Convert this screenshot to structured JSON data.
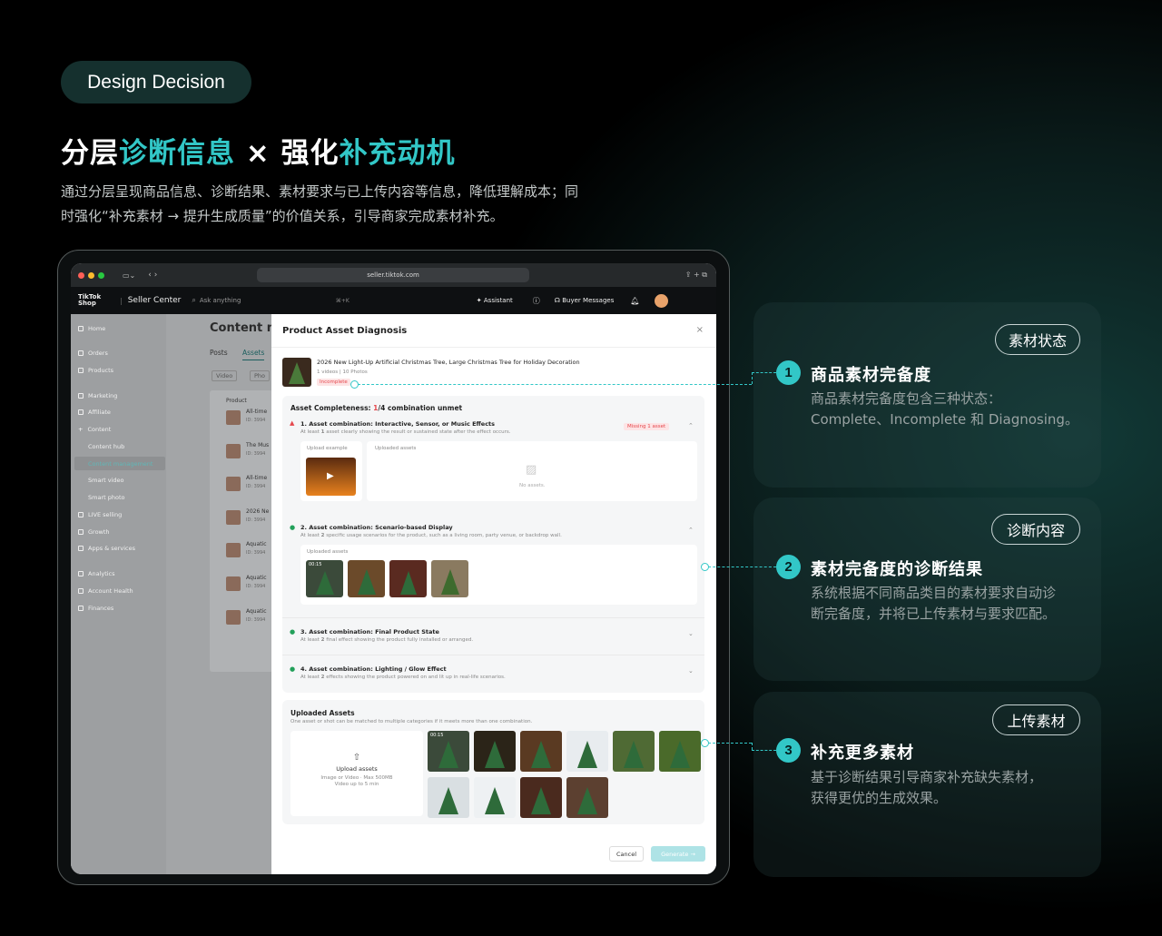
{
  "badge": "Design Decision",
  "headline": {
    "p1": "分层",
    "p2": "诊断信息",
    "p3": " × 强化",
    "p4": "补充动机"
  },
  "intro": "通过分层呈现商品信息、诊断结果、素材要求与已上传内容等信息，降低理解成本；同时强化“补充素材 → 提升生成质量”的价值关系，引导商家完成素材补充。",
  "browser": {
    "url": "seller.tiktok.com"
  },
  "topbar": {
    "brand": "TikTok Shop",
    "product": "Seller Center",
    "search_placeholder": "Ask anything",
    "shortcut": "⌘+K",
    "assistant": "Assistant",
    "buyer_messages": "Buyer Messages"
  },
  "sidebar": {
    "items": [
      "Home",
      "Orders",
      "Products",
      "Marketing",
      "Affiliate",
      "Content",
      "Content hub",
      "Content management",
      "Smart video",
      "Smart photo",
      "LIVE selling",
      "Growth",
      "Apps & services",
      "Analytics",
      "Account Health",
      "Finances"
    ]
  },
  "bg": {
    "title": "Content m",
    "tabs": [
      "Posts",
      "Assets"
    ],
    "chips": [
      "Video",
      "Pho"
    ],
    "col": "Product",
    "rows": [
      "All-time",
      "The Mus",
      "All-time",
      "2026 Ne",
      "Aquatic",
      "Aquatic",
      "Aquatic"
    ],
    "row_sub": "ID: 3994"
  },
  "modal": {
    "title": "Product Asset Diagnosis",
    "product_name": "2026 New Light-Up Artificial Christmas Tree, Large Christmas Tree for Holiday Decoration",
    "product_meta": "1 videos | 10 Photos",
    "status": "Incomplete",
    "completeness": {
      "label": "Asset Completeness: ",
      "unmet": "1",
      "rest": "/4 combination unmet"
    },
    "combos": [
      {
        "title": "1. Asset combination: Interactive, Sensor, or Music Effects",
        "desc_a": "At least ",
        "desc_n": "1",
        "desc_b": " asset clearly showing the result or sustained state after the effect occurs.",
        "badge": "Missing 1 asset"
      },
      {
        "title": "2. Asset combination: Scenario-based Display",
        "desc_a": "At least ",
        "desc_n": "2",
        "desc_b": " specific usage scenarios for the product, such as a living room, party venue, or backdrop wall."
      },
      {
        "title": "3. Asset combination: Final Product State",
        "desc_a": "At least ",
        "desc_n": "2",
        "desc_b": " final effect showing the product fully installed or arranged."
      },
      {
        "title": "4. Asset combination: Lighting / Glow Effect",
        "desc_a": "At least ",
        "desc_n": "2",
        "desc_b": " effects showing the product powered on and lit up in real-life scenarios."
      }
    ],
    "upload_example": "Upload example",
    "uploaded_assets_lbl": "Uploaded assets",
    "no_assets": "No assets.",
    "video_time": "00:15",
    "uploaded": {
      "title": "Uploaded Assets",
      "desc": "One asset or shot can be matched to multiple categories if it meets more than one combination.",
      "btn": "Upload assets",
      "hint1": "Image or Video · Max 500MB",
      "hint2": "Video up to 5 min"
    },
    "cancel": "Cancel",
    "generate": "Generate →"
  },
  "features": [
    {
      "num": "1",
      "tag": "素材状态",
      "title": "商品素材完备度",
      "desc1": "商品素材完备度包含三种状态：",
      "desc2": "Complete、Incomplete 和 Diagnosing。"
    },
    {
      "num": "2",
      "tag": "诊断内容",
      "title": "素材完备度的诊断结果",
      "desc1": "系统根据不同商品类目的素材要求自动诊",
      "desc2": "断完备度，并将已上传素材与要求匹配。"
    },
    {
      "num": "3",
      "tag": "上传素材",
      "title": "补充更多素材",
      "desc1": "基于诊断结果引导商家补充缺失素材，",
      "desc2": "获得更优的生成效果。"
    }
  ],
  "colors": {
    "accent": "#32c7c7",
    "incomplete": "#e5484d",
    "success": "#22a05a"
  }
}
